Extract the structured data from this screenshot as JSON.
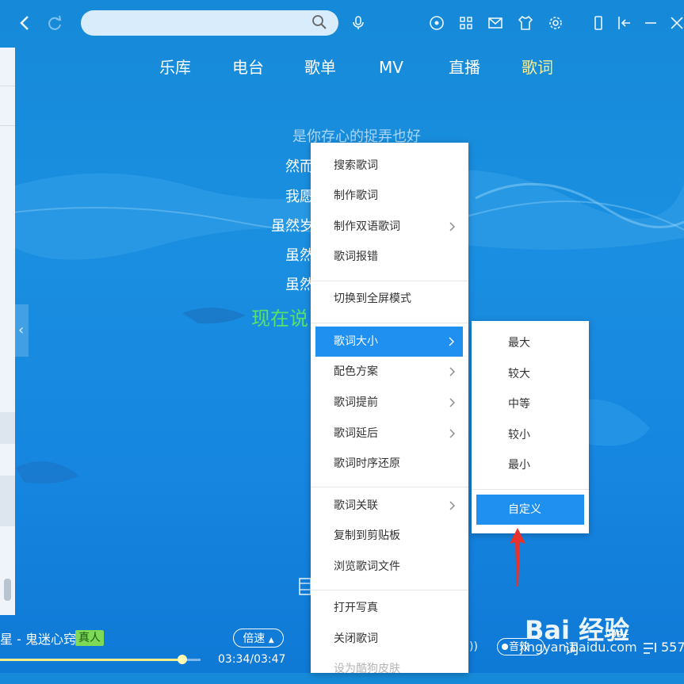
{
  "nav": {
    "items": [
      "乐库",
      "电台",
      "歌单",
      "MV",
      "直播",
      "歌词"
    ],
    "active_index": 5
  },
  "lyrics": {
    "lines": [
      "是你存心的捉弄也好",
      "然而",
      "我愿",
      "虽然岁",
      "虽然",
      "虽然"
    ],
    "current": "现在说"
  },
  "context_menu": {
    "items": [
      {
        "label": "搜索歌词",
        "submenu": false
      },
      {
        "label": "制作歌词",
        "submenu": false
      },
      {
        "label": "制作双语歌词",
        "submenu": true
      },
      {
        "label": "歌词报错",
        "submenu": false
      },
      {
        "label": "切换到全屏模式",
        "submenu": false
      },
      {
        "label": "歌词大小",
        "submenu": true,
        "highlighted": true
      },
      {
        "label": "配色方案",
        "submenu": true
      },
      {
        "label": "歌词提前",
        "submenu": true
      },
      {
        "label": "歌词延后",
        "submenu": true
      },
      {
        "label": "歌词时序还原",
        "submenu": false
      },
      {
        "label": "歌词关联",
        "submenu": true
      },
      {
        "label": "复制到剪贴板",
        "submenu": false
      },
      {
        "label": "浏览歌词文件",
        "submenu": false
      },
      {
        "label": "打开写真",
        "submenu": false
      },
      {
        "label": "关闭歌词",
        "submenu": false
      },
      {
        "label": "设为酷狗皮肤",
        "submenu": false,
        "disabled": true
      }
    ]
  },
  "size_submenu": {
    "items": [
      "最大",
      "较大",
      "中等",
      "较小",
      "最小"
    ],
    "custom": "自定义"
  },
  "player": {
    "song_title": "星 - 鬼迷心窍",
    "badge": "真人",
    "speed": "倍速",
    "time": "03:34/03:47",
    "progress": 0.91,
    "sound": "音效",
    "lyric_btn": "词",
    "count": "999+",
    "playlist_count": "557"
  },
  "watermark": {
    "logo": "Bai 经验",
    "url": "jingyan.baidu.com"
  },
  "colors": {
    "accent": "#1f8ff0",
    "current_lyric": "#58e16a",
    "active_nav": "#f7f09a",
    "arrow": "#e8322b"
  }
}
